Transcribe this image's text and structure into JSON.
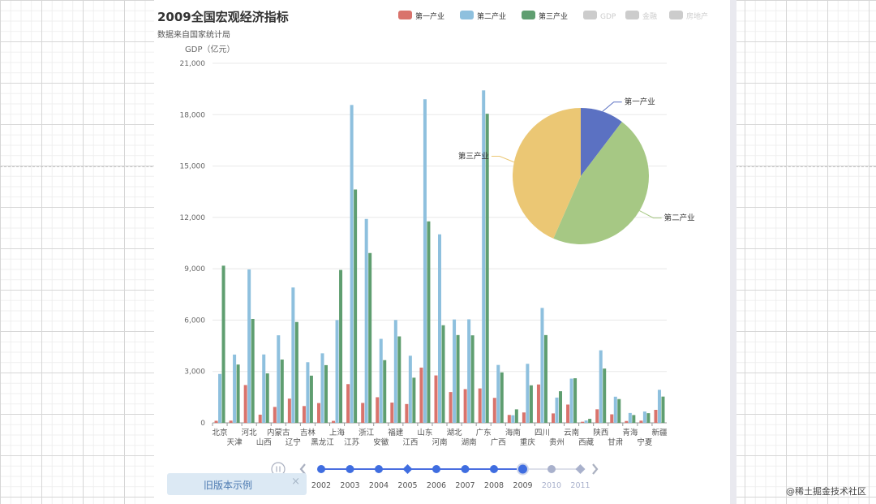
{
  "chart_data": {
    "type": "bar",
    "title": "2009全国宏观经济指标",
    "subtitle": "数据来自国家统计局",
    "ylabel": "GDP（亿元）",
    "ylim": [
      0,
      21000
    ],
    "yticks": [
      "0",
      "3,000",
      "6,000",
      "9,000",
      "12,000",
      "15,000",
      "18,000",
      "21,000"
    ],
    "grid": true,
    "legend": {
      "placement": "top-right",
      "items": [
        {
          "name": "第一产业",
          "color": "#d9736c",
          "active": true
        },
        {
          "name": "第二产业",
          "color": "#8ec0de",
          "active": true
        },
        {
          "name": "第三产业",
          "color": "#5f9e70",
          "active": true
        },
        {
          "name": "GDP",
          "color": "#cccccc",
          "active": false
        },
        {
          "name": "金融",
          "color": "#cccccc",
          "active": false
        },
        {
          "name": "房地产",
          "color": "#cccccc",
          "active": false
        }
      ]
    },
    "categories": [
      "北京",
      "天津",
      "河北",
      "山西",
      "内蒙古",
      "辽宁",
      "吉林",
      "黑龙江",
      "上海",
      "江苏",
      "浙江",
      "安徽",
      "福建",
      "江西",
      "山东",
      "河南",
      "湖北",
      "湖南",
      "广东",
      "广西",
      "海南",
      "重庆",
      "四川",
      "贵州",
      "云南",
      "西藏",
      "陕西",
      "甘肃",
      "青海",
      "宁夏",
      "新疆"
    ],
    "series": [
      {
        "name": "第一产业",
        "color": "#d9736c",
        "values": [
          120.2,
          128.85,
          2207.34,
          477.59,
          929.6,
          1414.9,
          980.57,
          1154.33,
          113.82,
          2261.86,
          1163.08,
          1495.45,
          1182.74,
          1098.66,
          3226.64,
          2769.05,
          1795.9,
          1969.69,
          2010.27,
          1458.49,
          462.19,
          606.8,
          2240.61,
          550.27,
          1067.6,
          63.88,
          789.64,
          497.05,
          107.4,
          127.25,
          759.74
        ]
      },
      {
        "name": "第二产业",
        "color": "#8ec0de",
        "values": [
          2855.55,
          3987.84,
          8959.83,
          3993.8,
          5114,
          7906.34,
          3541.92,
          4060.72,
          6001.78,
          18566.37,
          11908.49,
          4905.22,
          6005.3,
          3919.45,
          18901.83,
          11010.5,
          6038.08,
          6047.4,
          19419.7,
          3381.54,
          443.43,
          3448.77,
          6711.87,
          1476.62,
          2582.53,
          136.63,
          4236.42,
          1527.24,
          575.33,
          662.32,
          1929.59
        ]
      },
      {
        "name": "第三产业",
        "color": "#5f9e70",
        "values": [
          9179.19,
          3405.16,
          6068.31,
          2886.92,
          3696.65,
          5891.25,
          2756.26,
          3370.46,
          8930.85,
          13629.07,
          9918.78,
          3662.15,
          5048.49,
          2637.07,
          11768.18,
          5700.91,
          5127.12,
          5111.09,
          18052.59,
          2945.57,
          787.88,
          2191.53,
          5125.8,
          1846.47,
          2604.37,
          233.39,
          3170.12,
          1387.72,
          455.18,
          563.45,
          1533.33
        ]
      }
    ],
    "pie": {
      "type": "pie",
      "slices": [
        {
          "name": "第一产业",
          "value": 35226,
          "color": "#5b71c2"
        },
        {
          "name": "第二产业",
          "value": 157639,
          "color": "#a6c884"
        },
        {
          "name": "第三产业",
          "value": 148038,
          "color": "#ebc774"
        }
      ]
    }
  },
  "timeline": {
    "years": [
      {
        "label": "2002",
        "symbol": "circle",
        "state": "past"
      },
      {
        "label": "2003",
        "symbol": "circle",
        "state": "past"
      },
      {
        "label": "2004",
        "symbol": "circle",
        "state": "past"
      },
      {
        "label": "2005",
        "symbol": "diamond",
        "state": "past"
      },
      {
        "label": "2006",
        "symbol": "circle",
        "state": "past"
      },
      {
        "label": "2007",
        "symbol": "circle",
        "state": "past"
      },
      {
        "label": "2008",
        "symbol": "circle",
        "state": "past"
      },
      {
        "label": "2009",
        "symbol": "circle",
        "state": "current"
      },
      {
        "label": "2010",
        "symbol": "circle",
        "state": "future"
      },
      {
        "label": "2011",
        "symbol": "diamond",
        "state": "future"
      }
    ],
    "progress": 0.78
  },
  "toast": {
    "label": "旧版本示例",
    "close": "×"
  },
  "watermark": "@稀土掘金技术社区"
}
